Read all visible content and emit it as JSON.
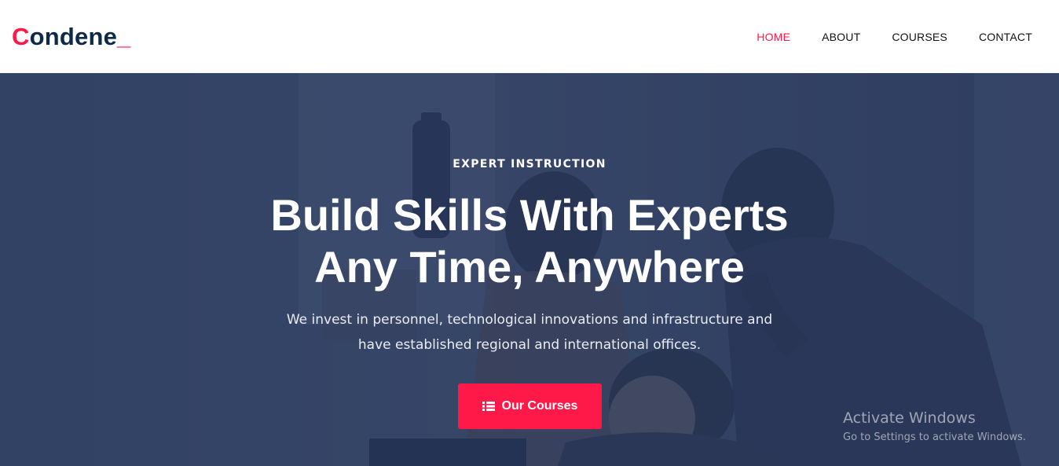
{
  "brand": {
    "first_letter": "C",
    "rest": "ondene",
    "suffix": "_"
  },
  "nav": {
    "items": [
      {
        "label": "HOME",
        "active": true
      },
      {
        "label": "ABOUT",
        "active": false
      },
      {
        "label": "COURSES",
        "active": false
      },
      {
        "label": "CONTACT",
        "active": false
      }
    ]
  },
  "hero": {
    "eyebrow": "EXPERT INSTRUCTION",
    "title_line1": "Build Skills With Experts",
    "title_line2": "Any Time, Anywhere",
    "subtitle": "We invest in personnel, technological innovations and infrastructure and have established regional and international offices.",
    "cta_label": "Our Courses",
    "cta_icon": "list-icon"
  },
  "watermark": {
    "title": "Activate Windows",
    "subtitle": "Go to Settings to activate Windows."
  },
  "colors": {
    "accent": "#ff1949",
    "brand_dark": "#0e2a4a",
    "overlay": "#26385f"
  }
}
